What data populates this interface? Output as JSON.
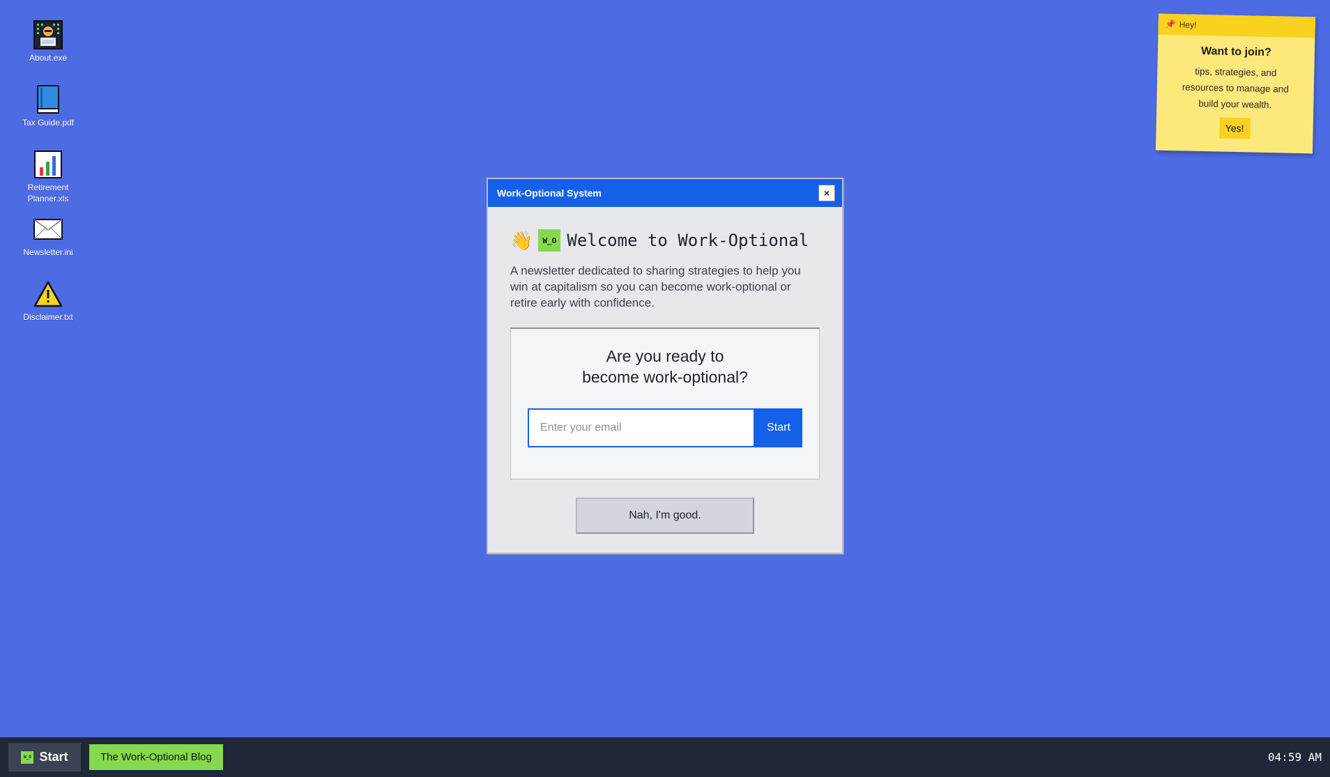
{
  "desktop": {
    "icons": [
      {
        "label": "About.exe",
        "icon": "robot-computer-icon"
      },
      {
        "label": "Tax Guide.pdf",
        "icon": "book-icon"
      },
      {
        "label": "Retirement Planner.xls",
        "icon": "bar-chart-icon"
      },
      {
        "label": "Newsletter.ini",
        "icon": "envelope-icon"
      },
      {
        "label": "Disclaimer.txt",
        "icon": "warning-icon"
      }
    ]
  },
  "sticky_note": {
    "header": "Hey!",
    "title": "Want to join?",
    "body": "tips, strategies, and resources to manage and build your wealth.",
    "button": "Yes!"
  },
  "window": {
    "title": "Work-Optional System",
    "close_label": "×",
    "logo_text": "W_O",
    "welcome_title": "Welcome to Work-Optional",
    "intro": "A newsletter dedicated to sharing strategies to help you win at capitalism so you can become work-optional or retire early with confidence.",
    "signup": {
      "question_line1": "Are you ready to",
      "question_line2": "become work-optional?",
      "email_placeholder": "Enter your email",
      "email_value": "",
      "submit_label": "Start"
    },
    "decline_label": "Nah, I'm good."
  },
  "taskbar": {
    "start_label": "Start",
    "start_logo_text": "W_O",
    "open_item": "The Work-Optional Blog",
    "clock": "04:59 AM"
  },
  "colors": {
    "desktop_bg": "#4d6be3",
    "accent_blue": "#1560e8",
    "brand_green": "#86d94f",
    "sticky_yellow": "#fde87b",
    "taskbar": "#1f2738"
  }
}
